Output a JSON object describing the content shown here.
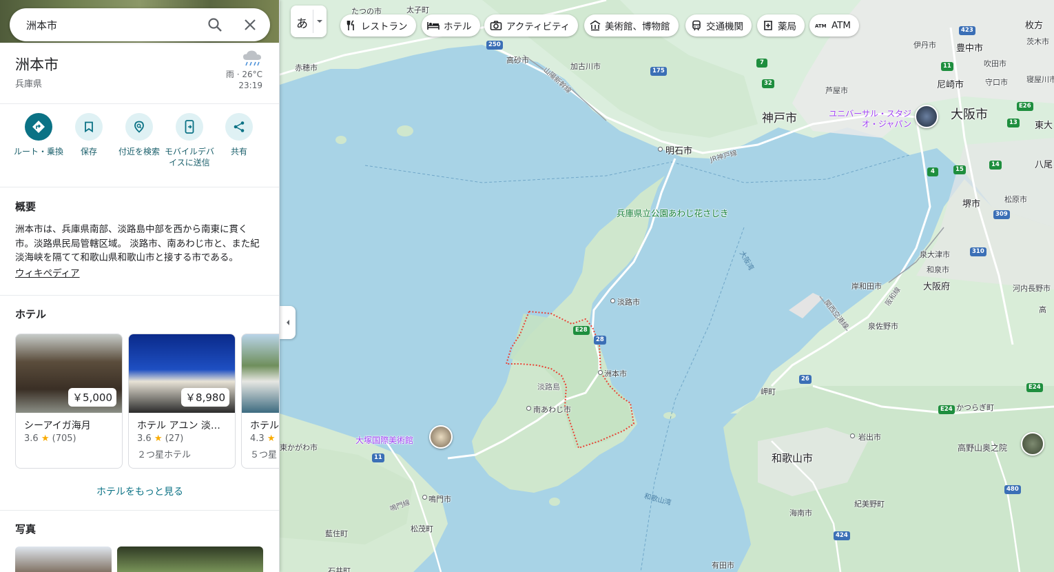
{
  "search": {
    "value": "洲本市"
  },
  "place": {
    "title": "洲本市",
    "subtitle": "兵庫県",
    "weather": {
      "condition_temp": "雨 · 26°C",
      "time": "23:19",
      "icon": "rain-cloud-icon"
    }
  },
  "actions": [
    {
      "label": "ルート・乗換",
      "icon": "directions-icon"
    },
    {
      "label": "保存",
      "icon": "bookmark-icon"
    },
    {
      "label": "付近を検索",
      "icon": "nearby-search-icon"
    },
    {
      "label": "モバイルデバイスに送信",
      "icon": "send-to-phone-icon"
    },
    {
      "label": "共有",
      "icon": "share-icon"
    }
  ],
  "overview": {
    "heading": "概要",
    "text": "洲本市は、兵庫県南部、淡路島中部を西から南東に貫く市。淡路県民局管轄区域。 淡路市、南あわじ市と、また紀淡海峡を隔てて和歌山県和歌山市と接する市である。",
    "link": "ウィキペディア"
  },
  "hotels": {
    "heading": "ホテル",
    "items": [
      {
        "price": "￥5,000",
        "name": "シーアイガ海月",
        "rating": "3.6",
        "reviews": "(705)",
        "class": ""
      },
      {
        "price": "￥8,980",
        "name": "ホテル アユン 淡…",
        "rating": "3.6",
        "reviews": "(27)",
        "class": "２つ星ホテル"
      },
      {
        "price": "",
        "name": "ホテル",
        "rating": "4.3",
        "reviews": "",
        "class": "５つ星"
      }
    ],
    "more": "ホテルをもっと見る"
  },
  "photos": {
    "heading": "写真"
  },
  "map": {
    "lang_button": "あ",
    "chips": [
      {
        "label": "レストラン",
        "icon": "restaurant-icon"
      },
      {
        "label": "ホテル",
        "icon": "hotel-icon"
      },
      {
        "label": "アクティビティ",
        "icon": "camera-icon"
      },
      {
        "label": "美術館、博物館",
        "icon": "museum-icon"
      },
      {
        "label": "交通機関",
        "icon": "transit-icon"
      },
      {
        "label": "薬局",
        "icon": "pharmacy-icon"
      },
      {
        "label": "ATM",
        "icon": "atm-icon"
      }
    ],
    "cities": {
      "kobe": "神戸市",
      "osaka": "大阪市",
      "akashi": "明石市",
      "sumoto": "洲本市",
      "awaji": "淡路市",
      "minamiawaji": "南あわじ市",
      "wakayama": "和歌山市",
      "naruto": "鳴門市",
      "sakai": "堺市",
      "amagasaki": "尼崎市",
      "toyonaka": "豊中市",
      "osakafu": "大阪府",
      "tatsuno": "たつの市",
      "taishi": "太子町",
      "akaho": "赤穂市",
      "takasago": "高砂市",
      "kakogawa": "加古川市",
      "ashiya": "芦屋市",
      "itami": "伊丹市",
      "suita": "吹田市",
      "moriguchi": "守口市",
      "neyagawa": "寝屋川市",
      "ibaraki": "茨木市",
      "hirakata": "枚方",
      "higashi": "東大",
      "yao": "八尾",
      "matsubara": "松原市",
      "izumiotsu": "泉大津市",
      "izumi": "和泉市",
      "kishiwada": "岸和田市",
      "izumisano": "泉佐野市",
      "kawachinagano": "河内長野市",
      "takaishi": "高",
      "misaki": "岬町",
      "iwade": "岩出市",
      "kinokawa": "紀美野町",
      "kainan": "海南市",
      "arida": "有田市",
      "katsuragi": "かつらぎ町",
      "matsushige": "松茂町",
      "aizumi": "藍住町",
      "higashikagawa": "東かがわ市",
      "awajishima": "淡路島",
      "ishii": "石井町",
      "koyasan": "高野山奥之院",
      "usj": "ユニバーサル・スタジオ・ジャパン",
      "otsuka": "大塚国際美術館",
      "park": "兵庫県立公園あわじ花さじき",
      "osaka_bay": "大阪湾",
      "kitan": "和歌山湾",
      "sanyo": "山陽新幹線",
      "jr_kobe": "JR神戸線",
      "naruto_line": "鳴門線",
      "kansai_airport": "関西空港線",
      "hanwa": "阪和線"
    }
  }
}
